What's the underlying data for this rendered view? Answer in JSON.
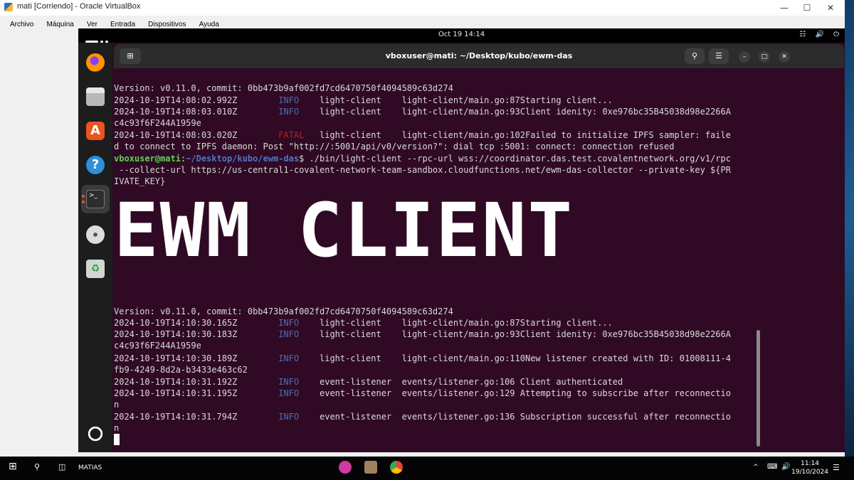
{
  "host": {
    "window_title": "mati [Corriendo] - Oracle VirtualBox",
    "menu": [
      "Archivo",
      "Máquina",
      "Ver",
      "Entrada",
      "Dispositivos",
      "Ayuda"
    ]
  },
  "guest": {
    "clock": "Oct 19  14:14",
    "terminal_title": "vboxuser@mati: ~/Desktop/kubo/ewm-das",
    "banner": "EWM CLIENT",
    "prompt_user": "vboxuser@mati",
    "prompt_path": "~/Desktop/kubo/ewm-das",
    "command": "$ ./bin/light-client --rpc-url wss://coordinator.das.test.covalentnetwork.org/v1/rpc",
    "command_l2": " --collect-url https://us-central1-covalent-network-team-sandbox.cloudfunctions.net/ewm-das-collector --private-key ${PR",
    "command_l3": "IVATE_KEY}",
    "log1": {
      "version": "Version: v0.11.0, commit: 0bb473b9af002fd7cd6470750f4094589c63d274",
      "l1_ts": "2024-10-19T14:08:02.992Z",
      "l1_lvl": "INFO",
      "l1_rest": "    light-client    light-client/main.go:87Starting client...",
      "l2_ts": "2024-10-19T14:08:03.010Z",
      "l2_lvl": "INFO",
      "l2_rest": "    light-client    light-client/main.go:93Client idenity: 0xe976bc35B45038d98e2266A",
      "l2_cont": "c4c93f6F244A1959e",
      "l3_ts": "2024-10-19T14:08:03.020Z",
      "l3_lvl": "FATAL",
      "l3_rest": "   light-client    light-client/main.go:102Failed to initialize IPFS sampler: faile",
      "l3_cont": "d to connect to IPFS daemon: Post \"http://:5001/api/v0/version?\": dial tcp :5001: connect: connection refused"
    },
    "log2": {
      "version": "Version: v0.11.0, commit: 0bb473b9af002fd7cd6470750f4094589c63d274",
      "l1_ts": "2024-10-19T14:10:30.165Z",
      "l1_lvl": "INFO",
      "l1_rest": "    light-client    light-client/main.go:87Starting client...",
      "l2_ts": "2024-10-19T14:10:30.183Z",
      "l2_lvl": "INFO",
      "l2_rest": "    light-client    light-client/main.go:93Client idenity: 0xe976bc35B45038d98e2266A",
      "l2_cont": "c4c93f6F244A1959e",
      "l3_ts": "2024-10-19T14:10:30.189Z",
      "l3_lvl": "INFO",
      "l3_rest": "    light-client    light-client/main.go:110New listener created with ID: 01008111-4",
      "l3_cont": "fb9-4249-8d2a-b3433e463c62",
      "l4_ts": "2024-10-19T14:10:31.192Z",
      "l4_lvl": "INFO",
      "l4_rest": "    event-listener  events/listener.go:106 Client authenticated",
      "l5_ts": "2024-10-19T14:10:31.195Z",
      "l5_lvl": "INFO",
      "l5_rest": "    event-listener  events/listener.go:129 Attempting to subscribe after reconnectio",
      "l5_cont": "n",
      "l6_ts": "2024-10-19T14:10:31.794Z",
      "l6_lvl": "INFO",
      "l6_rest": "    event-listener  events/listener.go:136 Subscription successful after reconnectio",
      "l6_cont": "n"
    }
  },
  "taskbar": {
    "user_label": "MATIAS",
    "time": "11:14",
    "date": "19/10/2024"
  }
}
